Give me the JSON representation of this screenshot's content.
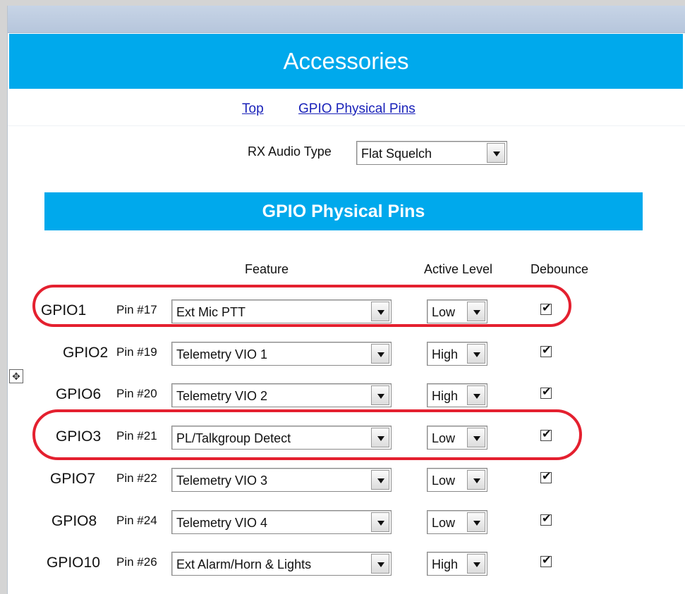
{
  "header": {
    "title": "Accessories"
  },
  "nav": {
    "links": [
      "Top",
      "GPIO Physical Pins"
    ]
  },
  "rx_audio": {
    "label": "RX Audio Type",
    "value": "Flat Squelch"
  },
  "gpio_section": {
    "title": "GPIO Physical Pins",
    "columns": {
      "feature": "Feature",
      "active_level": "Active Level",
      "debounce": "Debounce"
    },
    "rows": [
      {
        "gpio": "GPIO1",
        "pin": "Pin #17",
        "feature": "Ext Mic PTT",
        "level": "Low",
        "debounce": true
      },
      {
        "gpio": "GPIO2",
        "pin": "Pin #19",
        "feature": "Telemetry VIO 1",
        "level": "High",
        "debounce": true
      },
      {
        "gpio": "GPIO6",
        "pin": "Pin #20",
        "feature": "Telemetry VIO 2",
        "level": "High",
        "debounce": true
      },
      {
        "gpio": "GPIO3",
        "pin": "Pin #21",
        "feature": "PL/Talkgroup Detect",
        "level": "Low",
        "debounce": true
      },
      {
        "gpio": "GPIO7",
        "pin": "Pin #22",
        "feature": "Telemetry VIO 3",
        "level": "Low",
        "debounce": true
      },
      {
        "gpio": "GPIO8",
        "pin": "Pin #24",
        "feature": "Telemetry VIO 4",
        "level": "Low",
        "debounce": true
      },
      {
        "gpio": "GPIO10",
        "pin": "Pin #26",
        "feature": "Ext Alarm/Horn & Lights",
        "level": "High",
        "debounce": true
      }
    ]
  },
  "colors": {
    "banner": "#00a9ec",
    "link": "#1a22b9",
    "highlight": "#e4202f"
  }
}
